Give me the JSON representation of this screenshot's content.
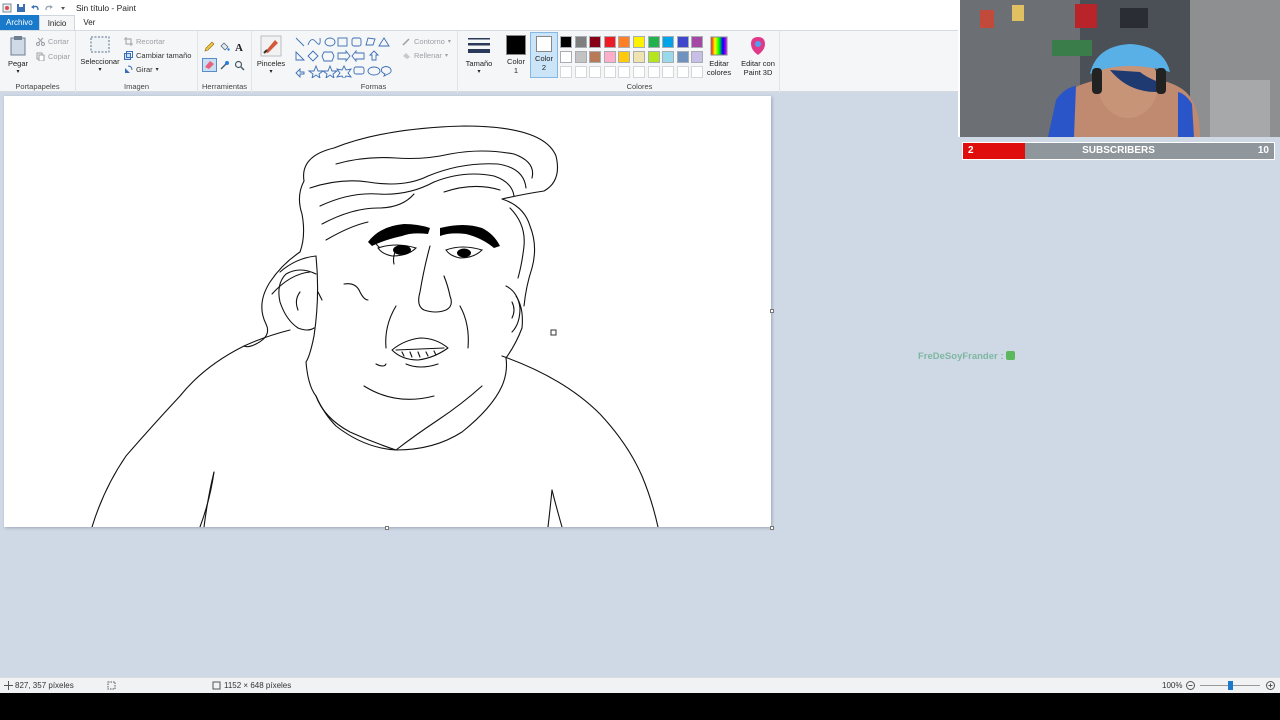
{
  "window": {
    "title": "Sin título - Paint"
  },
  "tabs": [
    "Archivo",
    "Inicio",
    "Ver"
  ],
  "clipboard": {
    "paste": "Pegar",
    "cut": "Cortar",
    "copy": "Copiar",
    "label": "Portapapeles"
  },
  "image": {
    "select": "Seleccionar",
    "crop": "Recortar",
    "resize": "Cambiar tamaño",
    "rotate": "Girar",
    "label": "Imagen"
  },
  "tools": {
    "label": "Herramientas",
    "brushes": "Pinceles"
  },
  "shapes": {
    "outline": "Contorno",
    "fill": "Rellenar",
    "label": "Formas"
  },
  "size": {
    "label": "Tamaño"
  },
  "colors": {
    "color1_label": "Color",
    "color1_num": "1",
    "color2_label": "Color",
    "color2_num": "2",
    "edit": "Editar",
    "edit2": "colores",
    "paint3d": "Editar con",
    "paint3d2": "Paint 3D",
    "label": "Colores",
    "color1": "#000000",
    "color2": "#ffffff",
    "row1": [
      "#000000",
      "#7f7f7f",
      "#880015",
      "#ed1c24",
      "#ff7f27",
      "#fff200",
      "#22b14c",
      "#00a2e8",
      "#3f48cc",
      "#a349a4"
    ],
    "row2": [
      "#ffffff",
      "#c3c3c3",
      "#b97a57",
      "#ffaec9",
      "#ffc90e",
      "#efe4b0",
      "#b5e61d",
      "#99d9ea",
      "#7092be",
      "#c8bfe7"
    ]
  },
  "status": {
    "cursor_pos": "827, 357 píxeles",
    "image_size": "1152 × 648 píxeles",
    "zoom": "100%",
    "zoom_level": 0.5
  },
  "stream": {
    "sub_count": "2",
    "sub_label": "SUBSCRIBERS",
    "sub_goal": "10",
    "chat_user": "FreDeSoyFrander :"
  }
}
